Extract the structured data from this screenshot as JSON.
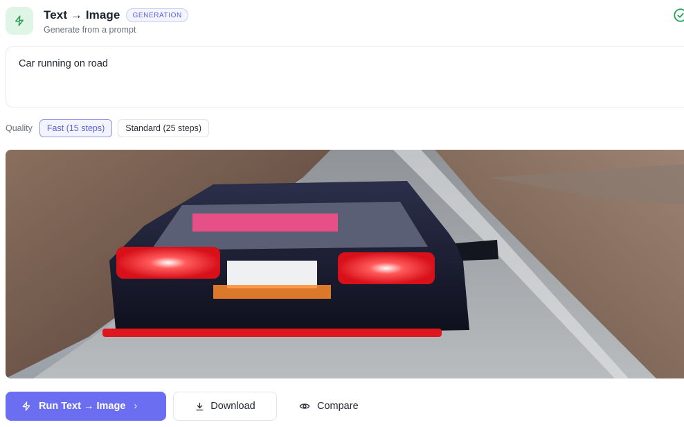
{
  "header": {
    "icon": "bolt-icon",
    "title": "Text → Image",
    "badge": "GENERATION",
    "subtitle": "Generate from a prompt",
    "status_icon": "check-circle-icon"
  },
  "prompt": {
    "value": "Car running on road"
  },
  "quality": {
    "label": "Quality",
    "options": [
      {
        "label": "Fast (15 steps)",
        "selected": true
      },
      {
        "label": "Standard (25 steps)",
        "selected": false
      }
    ]
  },
  "result_image": {
    "description_icon": "generated-image"
  },
  "actions": {
    "run_label": "Run Text → Image",
    "download_label": "Download",
    "compare_label": "Compare"
  },
  "colors": {
    "accent": "#6b6ef0",
    "success": "#22a35a",
    "icon_bg": "#dff5e6"
  }
}
